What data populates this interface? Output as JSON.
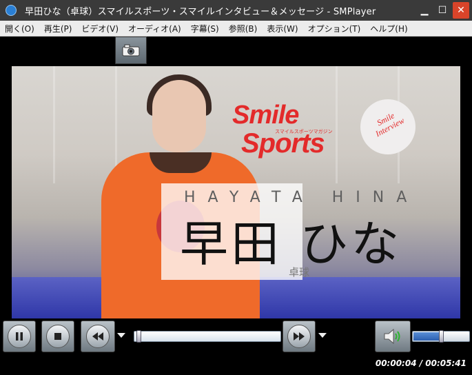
{
  "window": {
    "title": "早田ひな（卓球）スマイルスポーツ・スマイルインタビュー＆メッセージ - SMPlayer",
    "minimize_glyph": "▁",
    "maximize_glyph": "☐",
    "close_glyph": "✕"
  },
  "menu": [
    {
      "label": "開く(O)"
    },
    {
      "label": "再生(P)"
    },
    {
      "label": "ビデオ(V)"
    },
    {
      "label": "オーディオ(A)"
    },
    {
      "label": "字幕(S)"
    },
    {
      "label": "参照(B)"
    },
    {
      "label": "表示(W)"
    },
    {
      "label": "オプション(T)"
    },
    {
      "label": "ヘルプ(H)"
    }
  ],
  "toolbar": {
    "screenshot_icon": "camera-icon"
  },
  "video": {
    "logo_smile": "Smile",
    "logo_sports": "Sports",
    "logo_sub": "スマイルスポーツマガジン",
    "badge_line1": "Smile",
    "badge_line2": "Interview",
    "romaji": "HAYATA HINA",
    "name": "早田 ひな",
    "sport": "卓球"
  },
  "controls": {
    "pause_icon": "pause-icon",
    "stop_icon": "stop-icon",
    "rewind_icon": "rewind-icon",
    "forward_icon": "forward-icon",
    "volume_icon": "speaker-icon",
    "seek_fraction": 0.012,
    "volume_fraction": 0.5,
    "time": "00:00:04 / 00:05:41"
  },
  "colors": {
    "brand_red": "#e32a2a",
    "close_button": "#d9442a"
  }
}
